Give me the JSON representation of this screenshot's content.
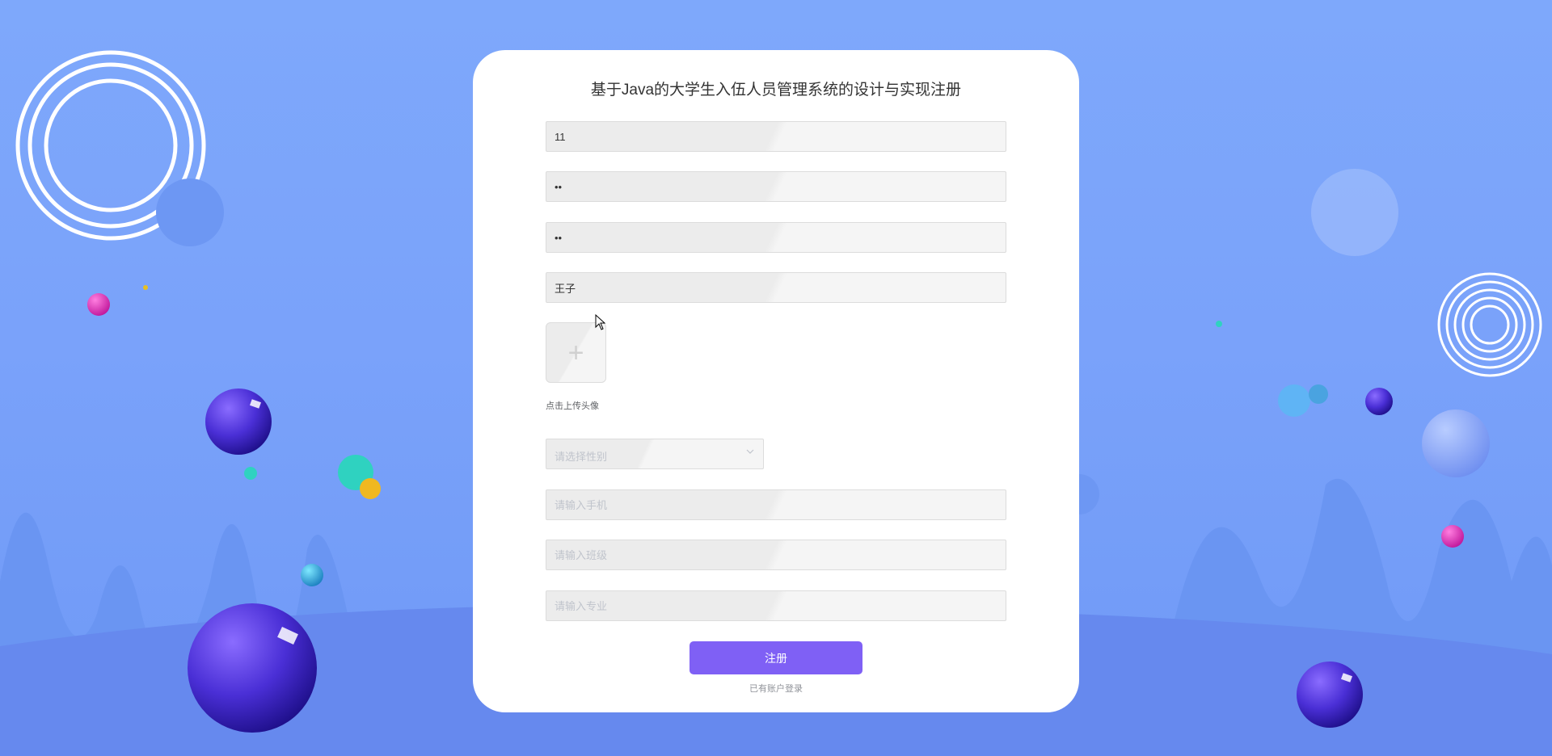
{
  "page": {
    "title": "基于Java的大学生入伍人员管理系统的设计与实现注册"
  },
  "form": {
    "account": {
      "value": "11",
      "placeholder": ""
    },
    "password": {
      "value": "••",
      "placeholder": ""
    },
    "confirm_password": {
      "value": "••",
      "placeholder": ""
    },
    "name": {
      "value": "王子",
      "placeholder": ""
    },
    "avatar": {
      "label": "点击上传头像",
      "icon": "plus-icon"
    },
    "gender": {
      "placeholder": "请选择性别",
      "icon": "chevron-down-icon"
    },
    "phone": {
      "value": "",
      "placeholder": "请输入手机"
    },
    "class": {
      "value": "",
      "placeholder": "请输入班级"
    },
    "major": {
      "value": "",
      "placeholder": "请输入专业"
    },
    "submit_label": "注册",
    "login_link": "已有账户登录"
  },
  "colors": {
    "background": "#7aa2fa",
    "button": "#7f60f5",
    "card": "#ffffff"
  }
}
